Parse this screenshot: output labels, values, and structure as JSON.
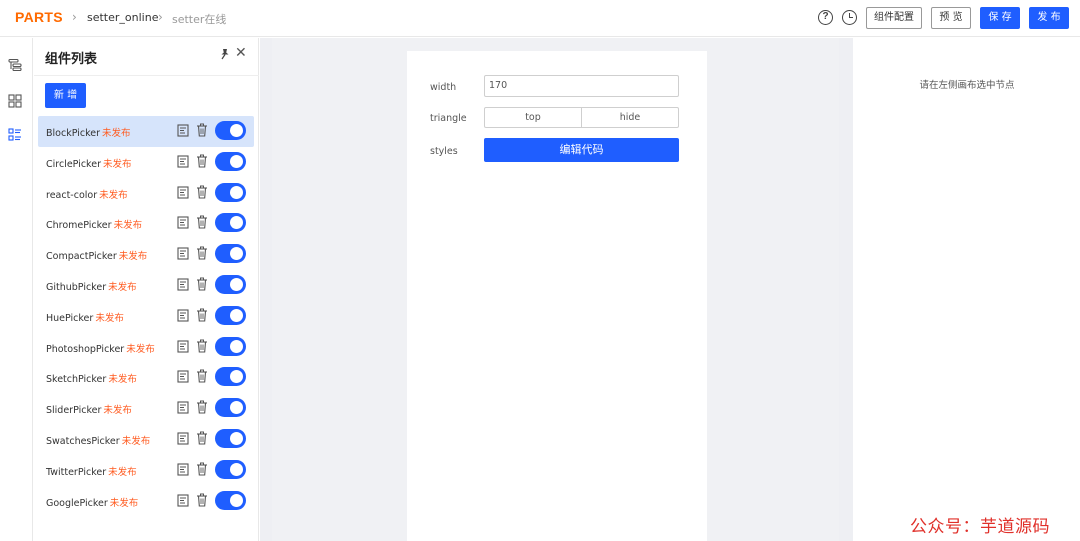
{
  "header": {
    "logo": "PARTS",
    "breadcrumbs": [
      "setter_online",
      "setter在线"
    ],
    "buttons": {
      "config": "组件配置",
      "preview": "预 览",
      "save": "保 存",
      "publish": "发 布"
    },
    "icons": [
      "help-circle-icon",
      "clock-icon"
    ]
  },
  "rail": {
    "icons": [
      "outline-tree-icon",
      "component-grid-icon",
      "component-list-icon"
    ]
  },
  "component_panel": {
    "title": "组件列表",
    "add_button": "新 增",
    "items": [
      {
        "name": "BlockPicker",
        "status": "未发布",
        "enabled": true,
        "selected": true
      },
      {
        "name": "CirclePicker",
        "status": "未发布",
        "enabled": true,
        "selected": false
      },
      {
        "name": "react-color",
        "status": "未发布",
        "enabled": true,
        "selected": false
      },
      {
        "name": "ChromePicker",
        "status": "未发布",
        "enabled": true,
        "selected": false
      },
      {
        "name": "CompactPicker",
        "status": "未发布",
        "enabled": true,
        "selected": false
      },
      {
        "name": "GithubPicker",
        "status": "未发布",
        "enabled": true,
        "selected": false
      },
      {
        "name": "HuePicker",
        "status": "未发布",
        "enabled": true,
        "selected": false
      },
      {
        "name": "PhotoshopPicker",
        "status": "未发布",
        "enabled": true,
        "selected": false
      },
      {
        "name": "SketchPicker",
        "status": "未发布",
        "enabled": true,
        "selected": false
      },
      {
        "name": "SliderPicker",
        "status": "未发布",
        "enabled": true,
        "selected": false
      },
      {
        "name": "SwatchesPicker",
        "status": "未发布",
        "enabled": true,
        "selected": false
      },
      {
        "name": "TwitterPicker",
        "status": "未发布",
        "enabled": true,
        "selected": false
      },
      {
        "name": "GooglePicker",
        "status": "未发布",
        "enabled": true,
        "selected": false
      }
    ]
  },
  "canvas": {
    "fields": {
      "width_label": "width",
      "width_value": "170",
      "triangle_label": "triangle",
      "triangle_options": [
        "top",
        "hide"
      ],
      "styles_label": "styles",
      "edit_code_button": "编辑代码"
    }
  },
  "right_panel": {
    "hint": "请在左侧画布选中节点"
  },
  "watermark": "公众号：芋道源码",
  "colors": {
    "brand": "#ff6a00",
    "primary": "#1f5eff",
    "status_unpublished": "#ff5a1f",
    "selected_row": "#d6e4fb",
    "canvas_bg": "#eeeff3"
  }
}
